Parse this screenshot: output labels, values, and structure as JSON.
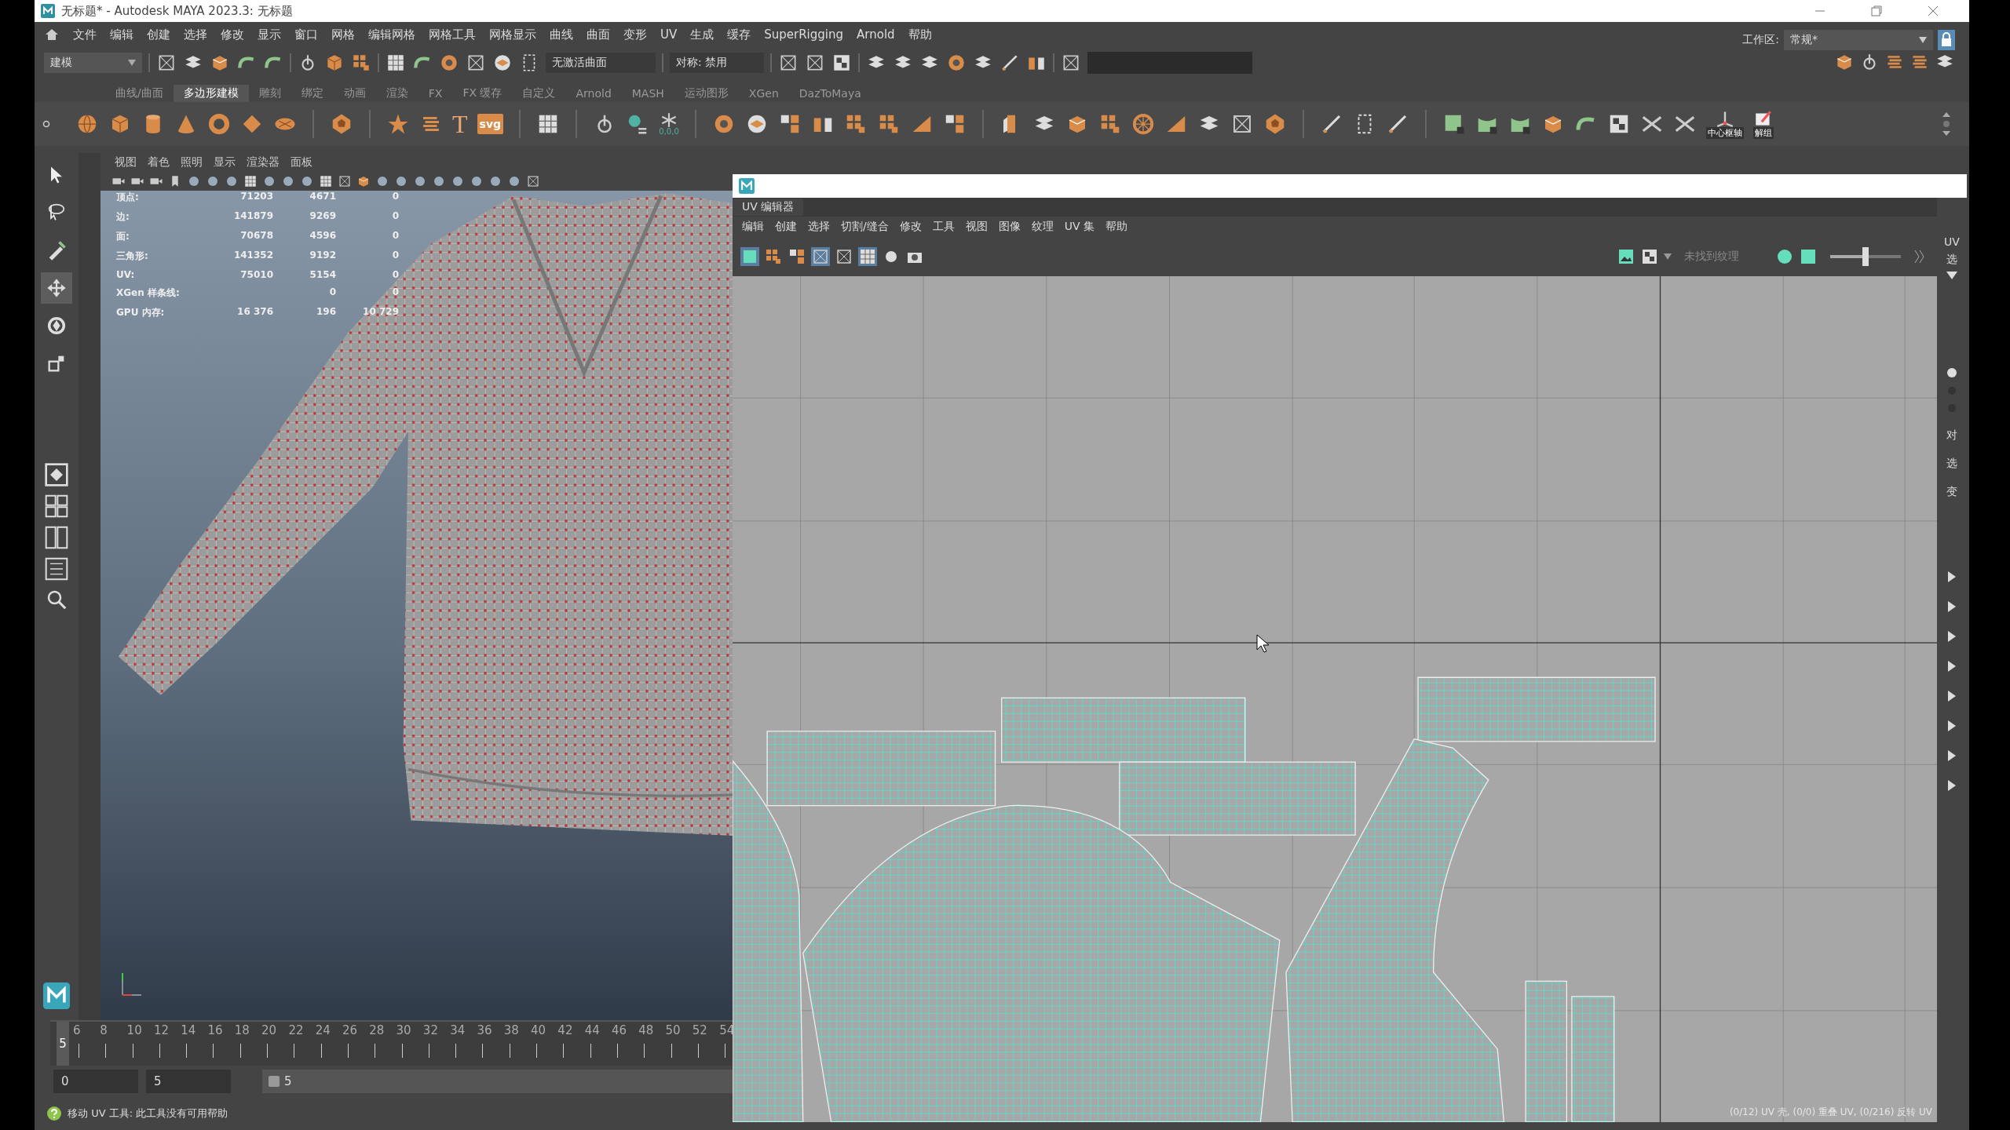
{
  "window": {
    "title": "无标题* - Autodesk MAYA 2023.3: 无标题"
  },
  "menu_bar": [
    "文件",
    "编辑",
    "创建",
    "选择",
    "修改",
    "显示",
    "窗口",
    "网格",
    "编辑网格",
    "网格工具",
    "网格显示",
    "曲线",
    "曲面",
    "变形",
    "UV",
    "生成",
    "缓存",
    "SuperRigging",
    "Arnold",
    "帮助"
  ],
  "status_line": {
    "mode": "建模",
    "live_surface": "无激活曲面",
    "symmetry": "对称: 禁用",
    "workspace_label": "工作区:",
    "workspace": "常规*"
  },
  "shelf": {
    "tabs": [
      {
        "label": "曲线/曲面",
        "selected": false
      },
      {
        "label": "多边形建模",
        "selected": true
      },
      {
        "label": "雕刻",
        "selected": false
      },
      {
        "label": "绑定",
        "selected": false
      },
      {
        "label": "动画",
        "selected": false
      },
      {
        "label": "渲染",
        "selected": false
      },
      {
        "label": "FX",
        "selected": false
      },
      {
        "label": "FX 缓存",
        "selected": false
      },
      {
        "label": "自定义",
        "selected": false
      },
      {
        "label": "Arnold",
        "selected": false
      },
      {
        "label": "MASH",
        "selected": false
      },
      {
        "label": "运动图形",
        "selected": false
      },
      {
        "label": "XGen",
        "selected": false
      },
      {
        "label": "DazToMaya",
        "selected": false
      }
    ],
    "labeled_buttons": [
      {
        "kind": "text",
        "label": "T"
      },
      {
        "kind": "svg",
        "label": "svg"
      },
      {
        "kind": "snow",
        "label": "0,0,0"
      },
      {
        "kind": "pivot",
        "label": "中心枢轴"
      },
      {
        "kind": "ungroup",
        "label": "解组"
      }
    ]
  },
  "toolbox": {
    "tools": [
      {
        "kind": "select",
        "selected": false
      },
      {
        "kind": "lasso",
        "selected": false
      },
      {
        "kind": "paint",
        "selected": false
      },
      {
        "kind": "move",
        "selected": true
      },
      {
        "kind": "rotate",
        "selected": false
      },
      {
        "kind": "scale",
        "selected": false
      }
    ]
  },
  "viewport": {
    "menu": [
      "视图",
      "着色",
      "照明",
      "显示",
      "渲染器",
      "面板"
    ],
    "stats": [
      {
        "label": "顶点:",
        "values": [
          "71203",
          "4671",
          "0"
        ]
      },
      {
        "label": "边:",
        "values": [
          "141879",
          "9269",
          "0"
        ]
      },
      {
        "label": "面:",
        "values": [
          "70678",
          "4596",
          "0"
        ]
      },
      {
        "label": "三角形:",
        "values": [
          "141352",
          "9192",
          "0"
        ]
      },
      {
        "label": "UV:",
        "values": [
          "75010",
          "5154",
          "0"
        ]
      },
      {
        "label": "XGen 样条线:",
        "values": [
          "0",
          "0"
        ]
      },
      {
        "label": "GPU 内存:",
        "values": [
          "16 376",
          "196",
          "10 729"
        ]
      }
    ]
  },
  "uv_editor": {
    "title": "UV 编辑器",
    "menu": [
      "编辑",
      "创建",
      "选择",
      "切割/缝合",
      "修改",
      "工具",
      "视图",
      "图像",
      "纹理",
      "UV 集",
      "帮助"
    ],
    "texture_status": "未找到纹理",
    "exposure": {
      "level": 0.5
    },
    "side_labels": [
      "UV",
      "选"
    ],
    "channel_labels": [
      "对",
      "选",
      "变"
    ],
    "status": "(0/12) UV 壳, (0/0) 重叠 UV, (0/216) 反转 UV"
  },
  "timeline": {
    "current_frame": "5",
    "ticks": [
      "6",
      "8",
      "10",
      "12",
      "14",
      "16",
      "18",
      "20",
      "22",
      "24",
      "26",
      "28",
      "30",
      "32",
      "34",
      "36",
      "38",
      "40",
      "42",
      "44",
      "46",
      "48",
      "50",
      "52",
      "54"
    ]
  },
  "range_slider": {
    "start": "0",
    "playback_start": "5",
    "range_value": "5"
  },
  "help_line": "移动 UV 工具: 此工具没有可用帮助"
}
